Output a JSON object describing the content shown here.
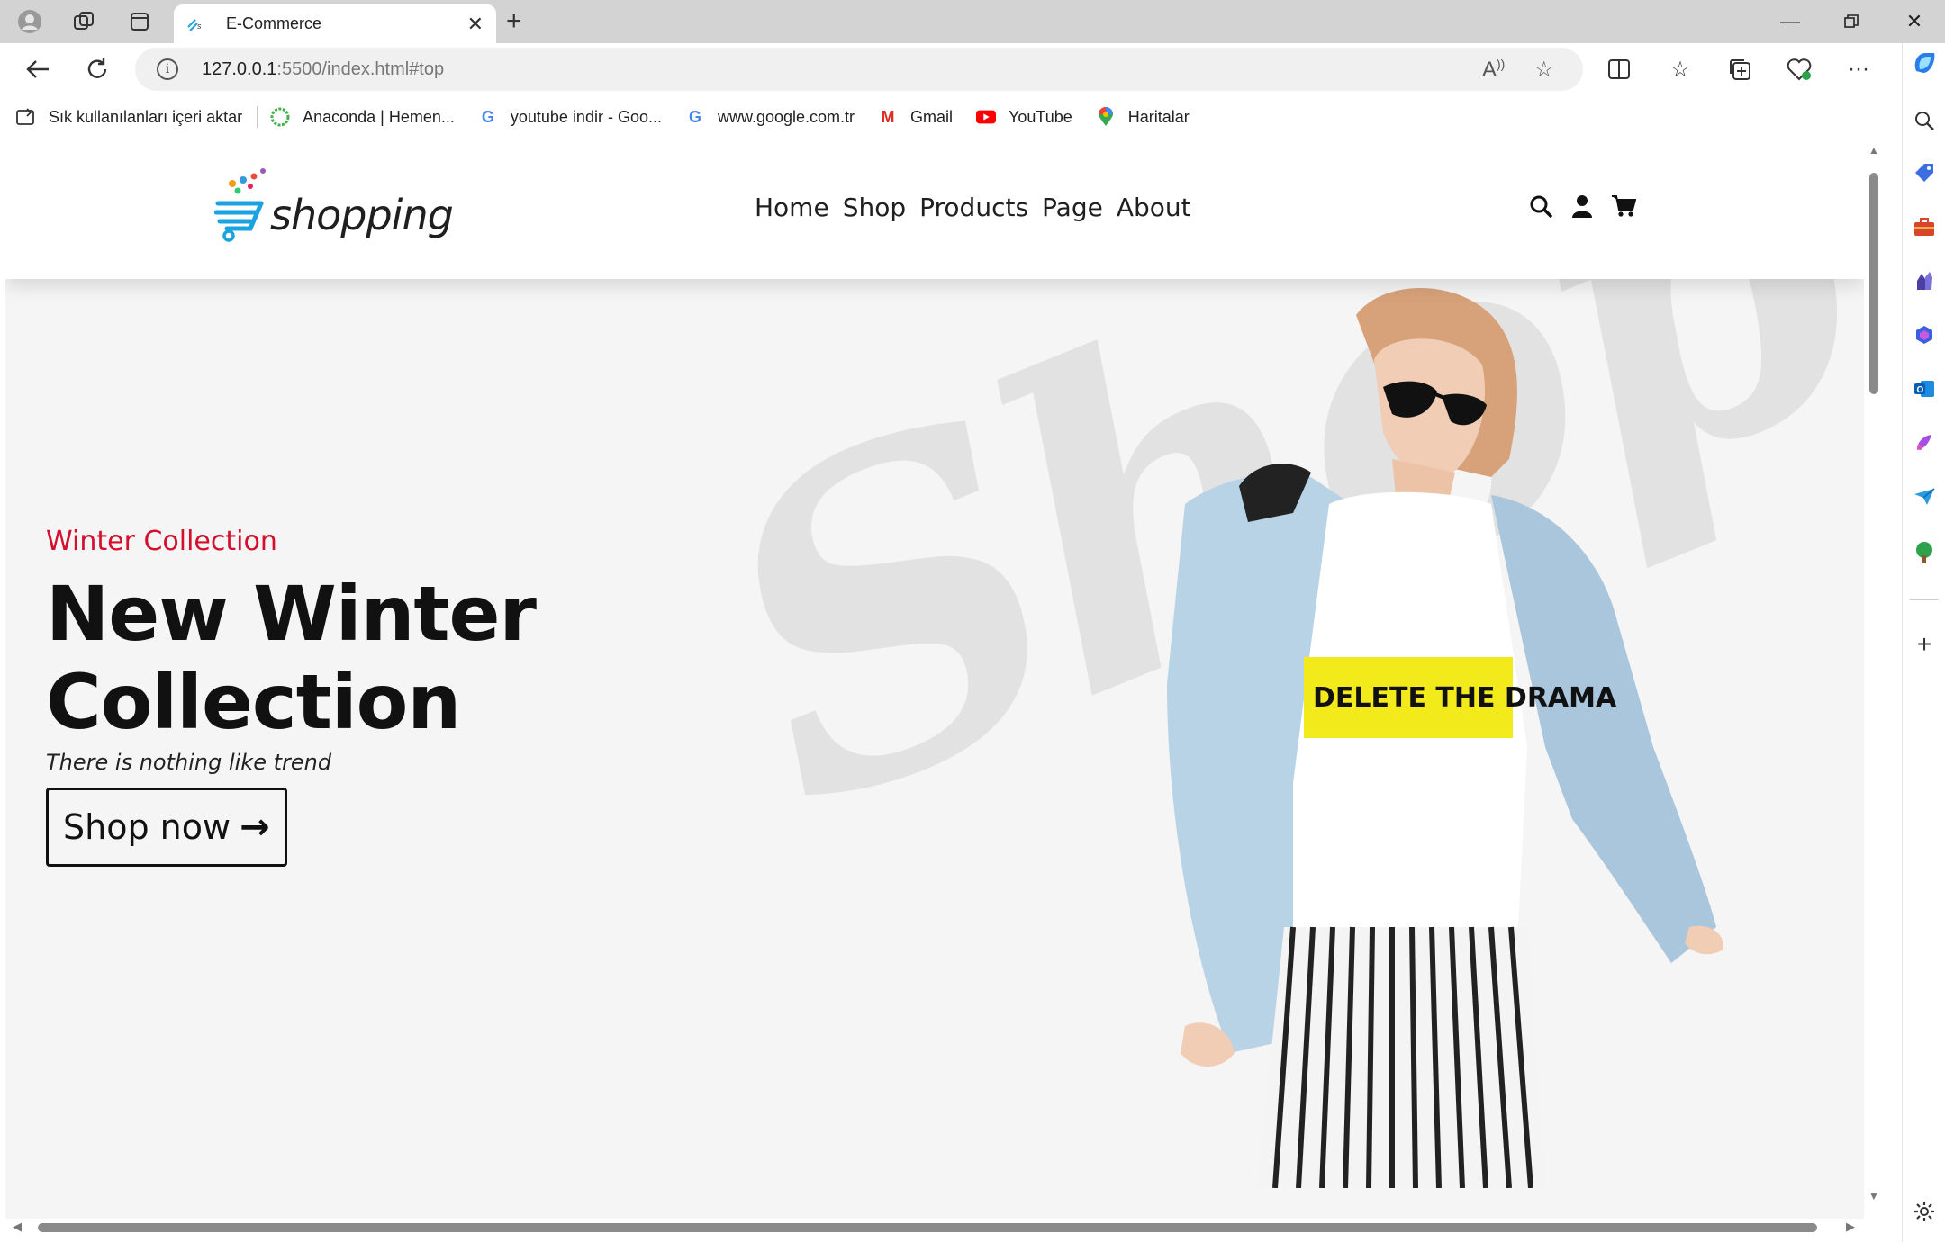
{
  "browser": {
    "tab": {
      "title": "E-Commerce",
      "close_icon": "close-icon"
    },
    "address": {
      "host": "127.0.0.1",
      "path": ":5500/index.html#top"
    },
    "bookmarks": [
      {
        "label": "Sık kullanılanları içeri aktar",
        "icon": "import-icon"
      },
      {
        "label": "Anaconda | Hemen...",
        "icon": "anaconda-icon"
      },
      {
        "label": "youtube indir - Goo...",
        "icon": "google-icon"
      },
      {
        "label": "www.google.com.tr",
        "icon": "google-icon"
      },
      {
        "label": "Gmail",
        "icon": "gmail-icon"
      },
      {
        "label": "YouTube",
        "icon": "youtube-icon"
      },
      {
        "label": "Haritalar",
        "icon": "maps-icon"
      }
    ]
  },
  "site": {
    "logo_text": "shopping",
    "nav": [
      "Home",
      "Shop",
      "Products",
      "Page",
      "About"
    ],
    "hero": {
      "eyebrow": "Winter Collection",
      "title_line1": "New Winter",
      "title_line2": "Collection",
      "subtitle": "There is nothing like trend",
      "cta_label": "Shop now",
      "cta_arrow": "→"
    },
    "watermark_text": "Shopping",
    "tshirt_text": "DELETE THE DRAMA",
    "accent_color": "#d4102e"
  }
}
